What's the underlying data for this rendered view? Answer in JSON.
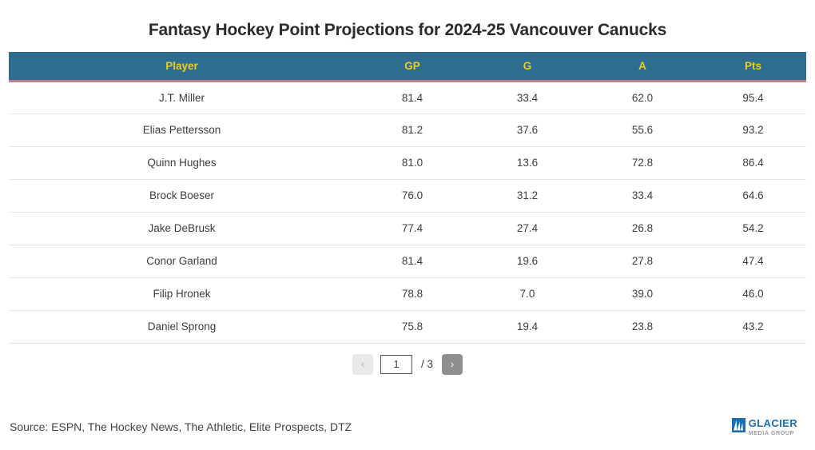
{
  "page": {
    "title": "Fantasy Hockey Point Projections for 2024-25 Vancouver Canucks",
    "background_color": "#ffffff"
  },
  "theme": {
    "header_bg": "#2d6d90",
    "header_text": "#f2cb21",
    "header_border": "#bf7f8c",
    "row_divider": "#e3e3e3",
    "body_text": "#3d3d3d",
    "pager_active_bg": "#8f8f8f",
    "pager_disabled_bg": "#e9e9e9"
  },
  "table": {
    "columns": [
      {
        "key": "player",
        "label": "Player",
        "align": "center"
      },
      {
        "key": "gp",
        "label": "GP",
        "align": "center"
      },
      {
        "key": "g",
        "label": "G",
        "align": "center"
      },
      {
        "key": "a",
        "label": "A",
        "align": "center"
      },
      {
        "key": "pts",
        "label": "Pts",
        "align": "center"
      }
    ],
    "rows": [
      {
        "player": "J.T. Miller",
        "gp": "81.4",
        "g": "33.4",
        "a": "62.0",
        "pts": "95.4"
      },
      {
        "player": "Elias Pettersson",
        "gp": "81.2",
        "g": "37.6",
        "a": "55.6",
        "pts": "93.2"
      },
      {
        "player": "Quinn Hughes",
        "gp": "81.0",
        "g": "13.6",
        "a": "72.8",
        "pts": "86.4"
      },
      {
        "player": "Brock Boeser",
        "gp": "76.0",
        "g": "31.2",
        "a": "33.4",
        "pts": "64.6"
      },
      {
        "player": "Jake DeBrusk",
        "gp": "77.4",
        "g": "27.4",
        "a": "26.8",
        "pts": "54.2"
      },
      {
        "player": "Conor Garland",
        "gp": "81.4",
        "g": "19.6",
        "a": "27.8",
        "pts": "47.4"
      },
      {
        "player": "Filip Hronek",
        "gp": "78.8",
        "g": "7.0",
        "a": "39.0",
        "pts": "46.0"
      },
      {
        "player": "Daniel Sprong",
        "gp": "75.8",
        "g": "19.4",
        "a": "23.8",
        "pts": "43.2"
      }
    ]
  },
  "pagination": {
    "prev_label": "‹",
    "prev_icon": "chevron-left-icon",
    "next_label": "›",
    "next_icon": "chevron-right-icon",
    "current_page": "1",
    "total_label": "/ 3",
    "total_pages": "3",
    "prev_enabled": false,
    "next_enabled": true
  },
  "footer": {
    "source": "Source: ESPN, The Hockey News, The Athletic, Elite Prospects, DTZ",
    "logo": {
      "name": "glacier-media-group-logo",
      "main": "GLACIER",
      "sub": "MEDIA GROUP",
      "main_color": "#1b6fb5",
      "sub_color": "#9a9a9a"
    }
  }
}
